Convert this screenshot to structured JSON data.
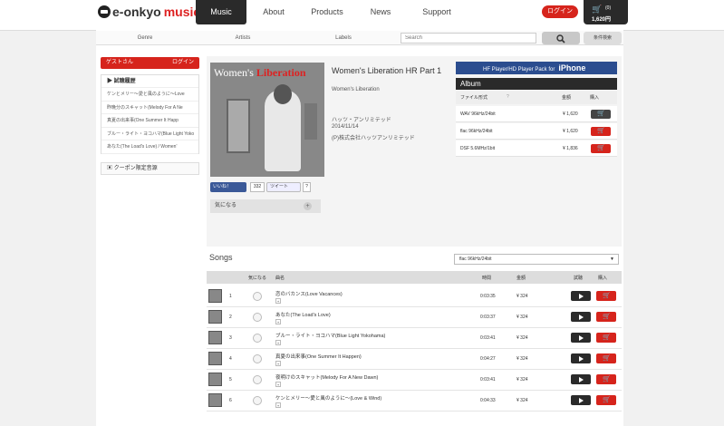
{
  "header": {
    "logo_prefix": "e-onkyo",
    "logo_suffix": "music",
    "nav": [
      {
        "label": "Music",
        "active": true
      },
      {
        "label": "About",
        "active": false
      },
      {
        "label": "Products",
        "active": false
      },
      {
        "label": "News",
        "active": false
      },
      {
        "label": "Support",
        "active": false
      }
    ],
    "login_label": "ログイン",
    "cart_count": "(0)",
    "cart_amount": "1,620円"
  },
  "subnav": {
    "tabs": [
      "Genre",
      "Artists",
      "Labels"
    ],
    "search_placeholder": "Search",
    "advanced_label": "条件検索"
  },
  "sidebar": {
    "user_label": "ゲストさん",
    "user_login": "ログイン",
    "history_title": "試聴履歴",
    "history_items": [
      "ケンとメリー〜愛と風のように〜Love",
      "昨晩分のスキャット(Melody For A Ne",
      "真夏の出来事(One Summer It Happ",
      "ブルー・ライト・ヨコハマ(Blue Light Yoko",
      "あなた(The Load's Love) / Women'"
    ],
    "coupon_label": "クーポン限定音源"
  },
  "album": {
    "cover_title_a": "Women's",
    "cover_title_b": "Liberation",
    "title": "Women's Liberation HR Part 1",
    "artist": "Women's Liberation",
    "label": "ハッツ・アンリミテッド",
    "date": "2014/11/14",
    "company": "(P)株式会社ハッツアンリミテッド",
    "like_label": "いいね！",
    "like_count": "332",
    "tweet_label": "ツイート",
    "help_label": "?",
    "fav_label": "気になる",
    "fav_plus": "+"
  },
  "purchase": {
    "banner_text": "HF Player/HD Player Pack for",
    "banner_brand": "iPhone",
    "section_title": "Album",
    "col_format": "ファイル形式",
    "col_help": "?",
    "col_price": "金額",
    "col_buy": "購入",
    "formats": [
      {
        "name": "WAV 96kHz/24bit",
        "price": "¥ 1,620",
        "in_cart": true
      },
      {
        "name": "flac 96kHz/24bit",
        "price": "¥ 1,620",
        "in_cart": false
      },
      {
        "name": "DSF 5.6MHz/1bit",
        "price": "¥ 1,836",
        "in_cart": false
      }
    ]
  },
  "songs": {
    "title": "Songs",
    "format_selected": "flac 96kHz/24bit",
    "columns": {
      "fav": "気になる",
      "name": "曲名",
      "time": "時間",
      "price": "金額",
      "preview": "試聴",
      "buy": "購入"
    },
    "rows": [
      {
        "num": "1",
        "name": "恋のバカンス(Love Vacances)",
        "time": "0:03:35",
        "price": "¥ 324"
      },
      {
        "num": "2",
        "name": "あなた(The Load's Love)",
        "time": "0:03:37",
        "price": "¥ 324"
      },
      {
        "num": "3",
        "name": "ブルー・ライト・ヨコハマ(Blue Light Yokohama)",
        "time": "0:03:41",
        "price": "¥ 324"
      },
      {
        "num": "4",
        "name": "真夏の出来事(One Summer It Happen)",
        "time": "0:04:27",
        "price": "¥ 324"
      },
      {
        "num": "5",
        "name": "夜明けのスキャット(Melody For A New Dawn)",
        "time": "0:03:41",
        "price": "¥ 324"
      },
      {
        "num": "6",
        "name": "ケンとメリー〜愛と風のように〜(Love & Wind)",
        "time": "0:04:33",
        "price": "¥ 324"
      }
    ]
  }
}
